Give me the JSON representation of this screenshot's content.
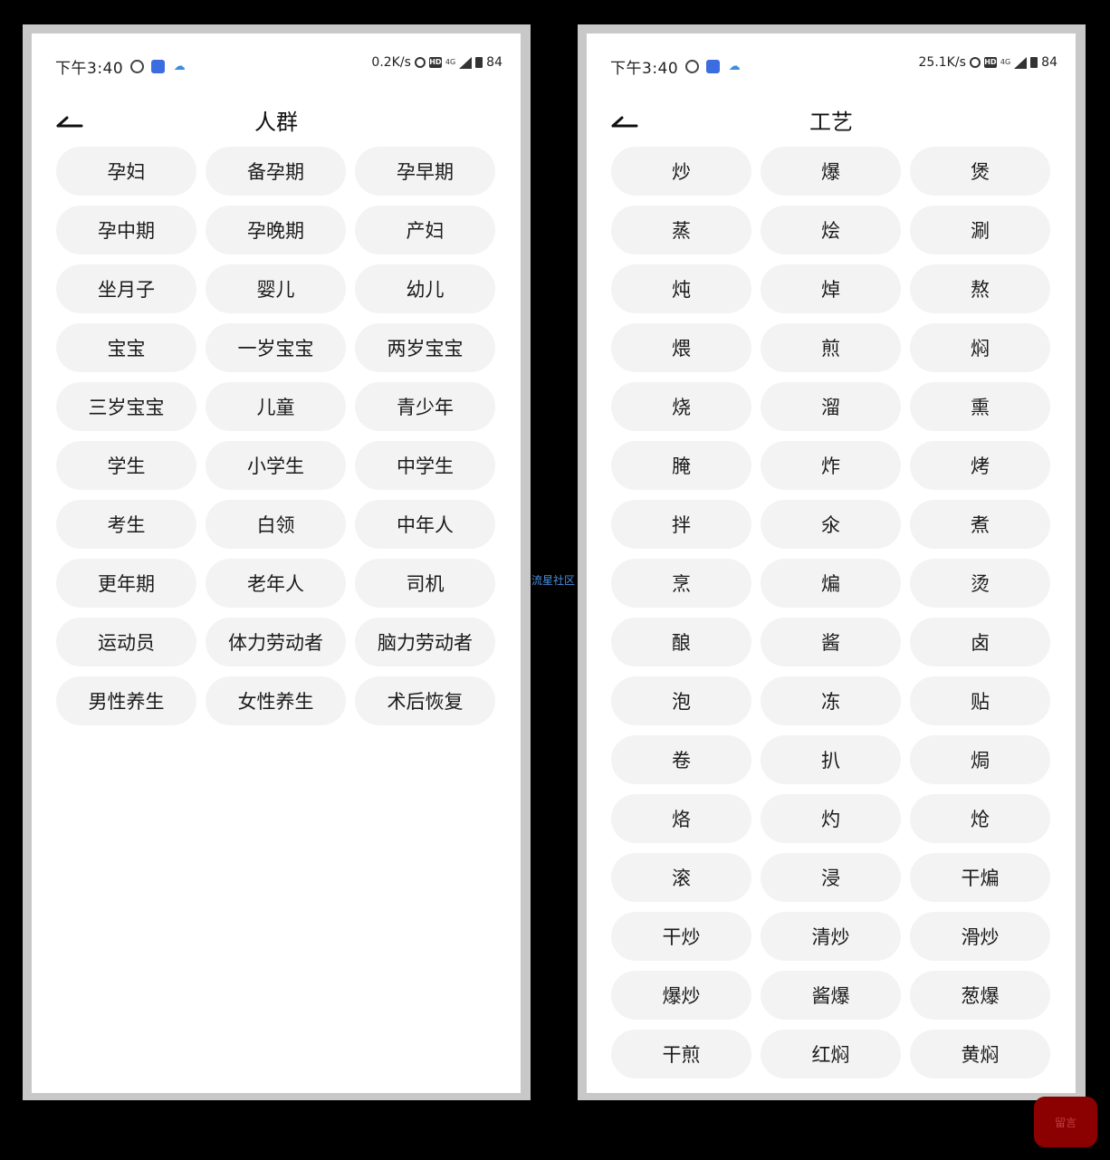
{
  "screens": [
    {
      "status": {
        "time": "下午3:40",
        "speed": "0.2K/s",
        "network": "4G",
        "battery": "84"
      },
      "title": "人群",
      "tags": [
        "孕妇",
        "备孕期",
        "孕早期",
        "孕中期",
        "孕晚期",
        "产妇",
        "坐月子",
        "婴儿",
        "幼儿",
        "宝宝",
        "一岁宝宝",
        "两岁宝宝",
        "三岁宝宝",
        "儿童",
        "青少年",
        "学生",
        "小学生",
        "中学生",
        "考生",
        "白领",
        "中年人",
        "更年期",
        "老年人",
        "司机",
        "运动员",
        "体力劳动者",
        "脑力劳动者",
        "男性养生",
        "女性养生",
        "术后恢复"
      ]
    },
    {
      "status": {
        "time": "下午3:40",
        "speed": "25.1K/s",
        "network": "4G",
        "battery": "84"
      },
      "title": "工艺",
      "tags": [
        "炒",
        "爆",
        "煲",
        "蒸",
        "烩",
        "涮",
        "炖",
        "焯",
        "熬",
        "煨",
        "煎",
        "焖",
        "烧",
        "溜",
        "熏",
        "腌",
        "炸",
        "烤",
        "拌",
        "氽",
        "煮",
        "烹",
        "煸",
        "烫",
        "酿",
        "酱",
        "卤",
        "泡",
        "冻",
        "贴",
        "卷",
        "扒",
        "焗",
        "烙",
        "灼",
        "炝",
        "滚",
        "浸",
        "干煸",
        "干炒",
        "清炒",
        "滑炒",
        "爆炒",
        "酱爆",
        "葱爆",
        "干煎",
        "红焖",
        "黄焖"
      ]
    }
  ],
  "watermark": "流星社区",
  "float_button": "留言",
  "icons": {
    "back": "back-arrow-icon",
    "notification_1": "q-app-icon",
    "notification_2": "app-notification-icon",
    "notification_3": "cloud-icon",
    "alarm": "alarm-icon",
    "hd": "hd-icon",
    "signal": "signal-icon",
    "battery": "battery-icon"
  }
}
